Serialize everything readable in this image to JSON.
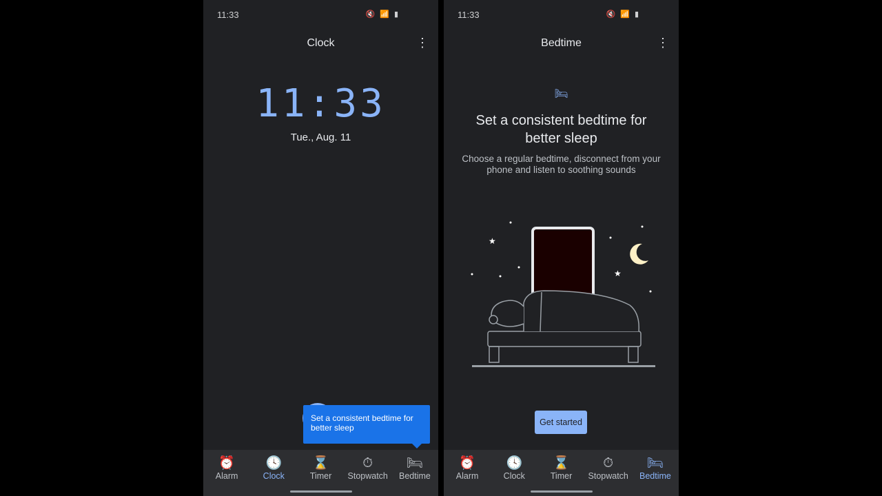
{
  "left": {
    "status_time": "11:33",
    "status_icons": "🔇 📶 ▮",
    "title": "Clock",
    "menu_icon": "more-vert",
    "time": "11:33",
    "date": "Tue., Aug. 11",
    "tooltip": "Set a consistent bedtime for better sleep",
    "active_tab": "Clock"
  },
  "right": {
    "status_time": "11:33",
    "status_icons": "🔇 📶 ▮",
    "title": "Bedtime",
    "menu_icon": "more-vert",
    "heading": "Set a consistent bedtime for better sleep",
    "subtext": "Choose a regular bedtime, disconnect from your phone and listen to soothing sounds",
    "button": "Get started",
    "active_tab": "Bedtime"
  },
  "nav": [
    {
      "label": "Alarm",
      "icon": "⏰"
    },
    {
      "label": "Clock",
      "icon": "🕓"
    },
    {
      "label": "Timer",
      "icon": "⌛"
    },
    {
      "label": "Stopwatch",
      "icon": "⏱"
    },
    {
      "label": "Bedtime",
      "icon": "🛏"
    }
  ],
  "colors": {
    "accent": "#8ab4f8",
    "background": "#202124",
    "tooltip": "#1a73e8"
  }
}
